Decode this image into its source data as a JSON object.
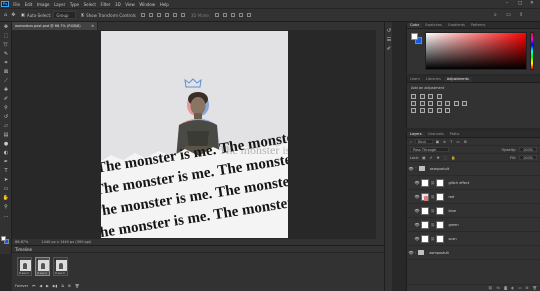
{
  "app": {
    "logo_text": "Ps"
  },
  "menu": [
    "File",
    "Edit",
    "Image",
    "Layer",
    "Type",
    "Select",
    "Filter",
    "3D",
    "View",
    "Window",
    "Help"
  ],
  "window_controls": {
    "minimize": "–",
    "maximize": "□",
    "close": "✕"
  },
  "options_bar": {
    "auto_select_label": "Auto-Select:",
    "auto_select_value": "Group",
    "transform_controls_label": "Show Transform Controls",
    "mode_3d_label": "3D Mode:"
  },
  "document": {
    "tab_title": "asmodeus post.psd @ 66.7% (RGB/8)",
    "tab_close": "✕",
    "zoom": "66.67%",
    "doc_info": "1440 px x 1440 px (300 ppi)"
  },
  "artwork": {
    "text_line": "The monster is me. The monster is me. The monster is me.",
    "ghost_line": "The monster is me. The monster",
    "colors": {
      "paper": "#e2e1e4",
      "ink": "#161616",
      "crown": "#5e92cf",
      "glitch_red": "#e06262",
      "glitch_blue": "#3f7bd6"
    }
  },
  "timeline": {
    "title": "Timeline",
    "frames": [
      {
        "index": "1",
        "duration": "0 sec.▾"
      },
      {
        "index": "2",
        "duration": "0 sec.▾"
      },
      {
        "index": "3",
        "duration": "0 sec.▾"
      }
    ],
    "loop_value": "Forever"
  },
  "color_panel": {
    "tabs": [
      "Color",
      "Swatches",
      "Gradients",
      "Patterns"
    ],
    "fg_color": "#ffffff",
    "bg_color": "#1a5bd6"
  },
  "adjustments_panel": {
    "tabs": [
      "Learn",
      "Libraries",
      "Adjustments"
    ],
    "title": "Add an adjustment"
  },
  "layers_panel": {
    "tabs": [
      "Layers",
      "Channels",
      "Paths"
    ],
    "kind_label": "Kind",
    "blend_mode": "Pass Through",
    "opacity_label": "Opacity:",
    "opacity_value": "100%",
    "lock_label": "Lock:",
    "fill_label": "Fill:",
    "fill_value": "100%",
    "layers": [
      {
        "name": "asmpostult",
        "type": "group",
        "expanded": true
      },
      {
        "name": "glitch effect",
        "type": "pixel"
      },
      {
        "name": "red",
        "type": "pixel"
      },
      {
        "name": "blue",
        "type": "pixel"
      },
      {
        "name": "green",
        "type": "pixel"
      },
      {
        "name": "scan",
        "type": "pixel"
      },
      {
        "name": "asmpostult",
        "type": "group",
        "expanded": false
      }
    ]
  }
}
